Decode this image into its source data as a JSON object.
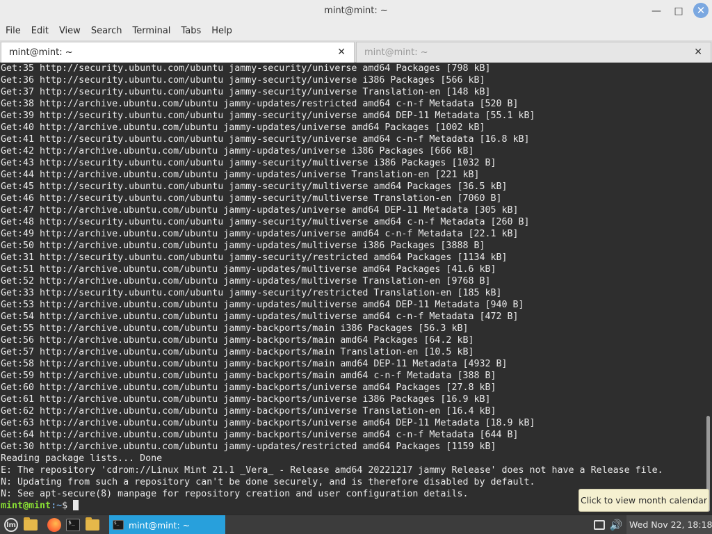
{
  "window": {
    "title": "mint@mint: ~",
    "minimize_glyph": "—",
    "maximize_glyph": "□",
    "close_glyph": "✕"
  },
  "menu": {
    "items": [
      "File",
      "Edit",
      "View",
      "Search",
      "Terminal",
      "Tabs",
      "Help"
    ]
  },
  "tabs": [
    {
      "label": "mint@mint: ~",
      "close": "✕",
      "active": true
    },
    {
      "label": "mint@mint: ~",
      "close": "✕",
      "active": false
    }
  ],
  "terminal": {
    "lines": [
      "Get:35 http://security.ubuntu.com/ubuntu jammy-security/universe amd64 Packages [798 kB]",
      "Get:36 http://security.ubuntu.com/ubuntu jammy-security/universe i386 Packages [566 kB]",
      "Get:37 http://security.ubuntu.com/ubuntu jammy-security/universe Translation-en [148 kB]",
      "Get:38 http://archive.ubuntu.com/ubuntu jammy-updates/restricted amd64 c-n-f Metadata [520 B]",
      "Get:39 http://security.ubuntu.com/ubuntu jammy-security/universe amd64 DEP-11 Metadata [55.1 kB]",
      "Get:40 http://archive.ubuntu.com/ubuntu jammy-updates/universe amd64 Packages [1002 kB]",
      "Get:41 http://security.ubuntu.com/ubuntu jammy-security/universe amd64 c-n-f Metadata [16.8 kB]",
      "Get:42 http://archive.ubuntu.com/ubuntu jammy-updates/universe i386 Packages [666 kB]",
      "Get:43 http://security.ubuntu.com/ubuntu jammy-security/multiverse i386 Packages [1032 B]",
      "Get:44 http://archive.ubuntu.com/ubuntu jammy-updates/universe Translation-en [221 kB]",
      "Get:45 http://security.ubuntu.com/ubuntu jammy-security/multiverse amd64 Packages [36.5 kB]",
      "Get:46 http://security.ubuntu.com/ubuntu jammy-security/multiverse Translation-en [7060 B]",
      "Get:47 http://archive.ubuntu.com/ubuntu jammy-updates/universe amd64 DEP-11 Metadata [305 kB]",
      "Get:48 http://security.ubuntu.com/ubuntu jammy-security/multiverse amd64 c-n-f Metadata [260 B]",
      "Get:49 http://archive.ubuntu.com/ubuntu jammy-updates/universe amd64 c-n-f Metadata [22.1 kB]",
      "Get:50 http://archive.ubuntu.com/ubuntu jammy-updates/multiverse i386 Packages [3888 B]",
      "Get:31 http://security.ubuntu.com/ubuntu jammy-security/restricted amd64 Packages [1134 kB]",
      "Get:51 http://archive.ubuntu.com/ubuntu jammy-updates/multiverse amd64 Packages [41.6 kB]",
      "Get:52 http://archive.ubuntu.com/ubuntu jammy-updates/multiverse Translation-en [9768 B]",
      "Get:33 http://security.ubuntu.com/ubuntu jammy-security/restricted Translation-en [185 kB]",
      "Get:53 http://archive.ubuntu.com/ubuntu jammy-updates/multiverse amd64 DEP-11 Metadata [940 B]",
      "Get:54 http://archive.ubuntu.com/ubuntu jammy-updates/multiverse amd64 c-n-f Metadata [472 B]",
      "Get:55 http://archive.ubuntu.com/ubuntu jammy-backports/main i386 Packages [56.3 kB]",
      "Get:56 http://archive.ubuntu.com/ubuntu jammy-backports/main amd64 Packages [64.2 kB]",
      "Get:57 http://archive.ubuntu.com/ubuntu jammy-backports/main Translation-en [10.5 kB]",
      "Get:58 http://archive.ubuntu.com/ubuntu jammy-backports/main amd64 DEP-11 Metadata [4932 B]",
      "Get:59 http://archive.ubuntu.com/ubuntu jammy-backports/main amd64 c-n-f Metadata [388 B]",
      "Get:60 http://archive.ubuntu.com/ubuntu jammy-backports/universe amd64 Packages [27.8 kB]",
      "Get:61 http://archive.ubuntu.com/ubuntu jammy-backports/universe i386 Packages [16.9 kB]",
      "Get:62 http://archive.ubuntu.com/ubuntu jammy-backports/universe Translation-en [16.4 kB]",
      "Get:63 http://archive.ubuntu.com/ubuntu jammy-backports/universe amd64 DEP-11 Metadata [18.9 kB]",
      "Get:64 http://archive.ubuntu.com/ubuntu jammy-backports/universe amd64 c-n-f Metadata [644 B]",
      "Get:30 http://archive.ubuntu.com/ubuntu jammy-updates/restricted amd64 Packages [1159 kB]",
      "Reading package lists... Done",
      "E: The repository 'cdrom://Linux Mint 21.1 _Vera_ - Release amd64 20221217 jammy Release' does not have a Release file.",
      "N: Updating from such a repository can't be done securely, and is therefore disabled by default.",
      "N: See apt-secure(8) manpage for repository creation and user configuration details."
    ],
    "prompt_user": "mint@mint",
    "prompt_path": ":~",
    "prompt_symbol": "$ "
  },
  "tooltip": {
    "text": "Click to view month calendar"
  },
  "taskbar": {
    "active_task_label": "mint@mint: ~",
    "terminal_icon_glyph": "$_",
    "volume_glyph": "🔊",
    "clock": "Wed Nov 22, 18:18",
    "colors": {
      "active_task": "#28a0dc",
      "panel": "#3c3c3c"
    }
  },
  "colors": {
    "terminal_bg": "#2e2e2e",
    "terminal_fg": "#eaeaea",
    "prompt_user": "#8ae234",
    "prompt_path": "#729fcf",
    "close_button": "#7aa7e0"
  }
}
